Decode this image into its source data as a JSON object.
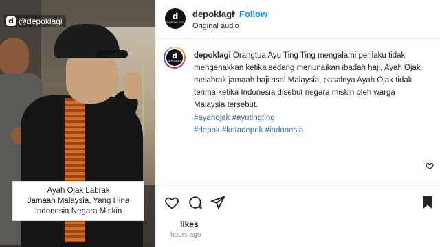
{
  "media": {
    "watermark": "@depoklagi",
    "caption_lines": [
      "Ayah Ojak Labrak",
      "Jamaah Malaysia, Yang Hina",
      "Indonesia Negara Miskin"
    ]
  },
  "header": {
    "username": "depoklagi",
    "separator": "•",
    "follow_label": "Follow",
    "audio": "Original audio",
    "avatar_letter": "d",
    "avatar_text": "DEPOKLAGI"
  },
  "post": {
    "username": "depoklagi",
    "text": "Orangtua Ayu Ting Ting mengalami perilaku tidak mengenakkan ketika sedang menunaikan ibadah haji, Ayah Ojak melabrak jamaah haji asal Malaysia, pasalnya Ayah Ojak tidak terima ketika Indonesia disebut negara miskin oleh warga Malaysia tersebut.",
    "hashtags": [
      "#ayahojak",
      "#ayutingting",
      "#depok",
      "#kotadepok",
      "#indonesia"
    ]
  },
  "footer": {
    "likes": "likes",
    "time": "hours ago"
  },
  "colors": {
    "follow": "#0095f6",
    "hashtag": "#3a6ea5",
    "text": "#262626",
    "muted": "#8e8e8e"
  },
  "icons": {
    "like": "heart-icon",
    "comment": "comment-icon",
    "share": "send-icon",
    "save": "bookmark-icon",
    "comment_like": "heart-icon"
  }
}
